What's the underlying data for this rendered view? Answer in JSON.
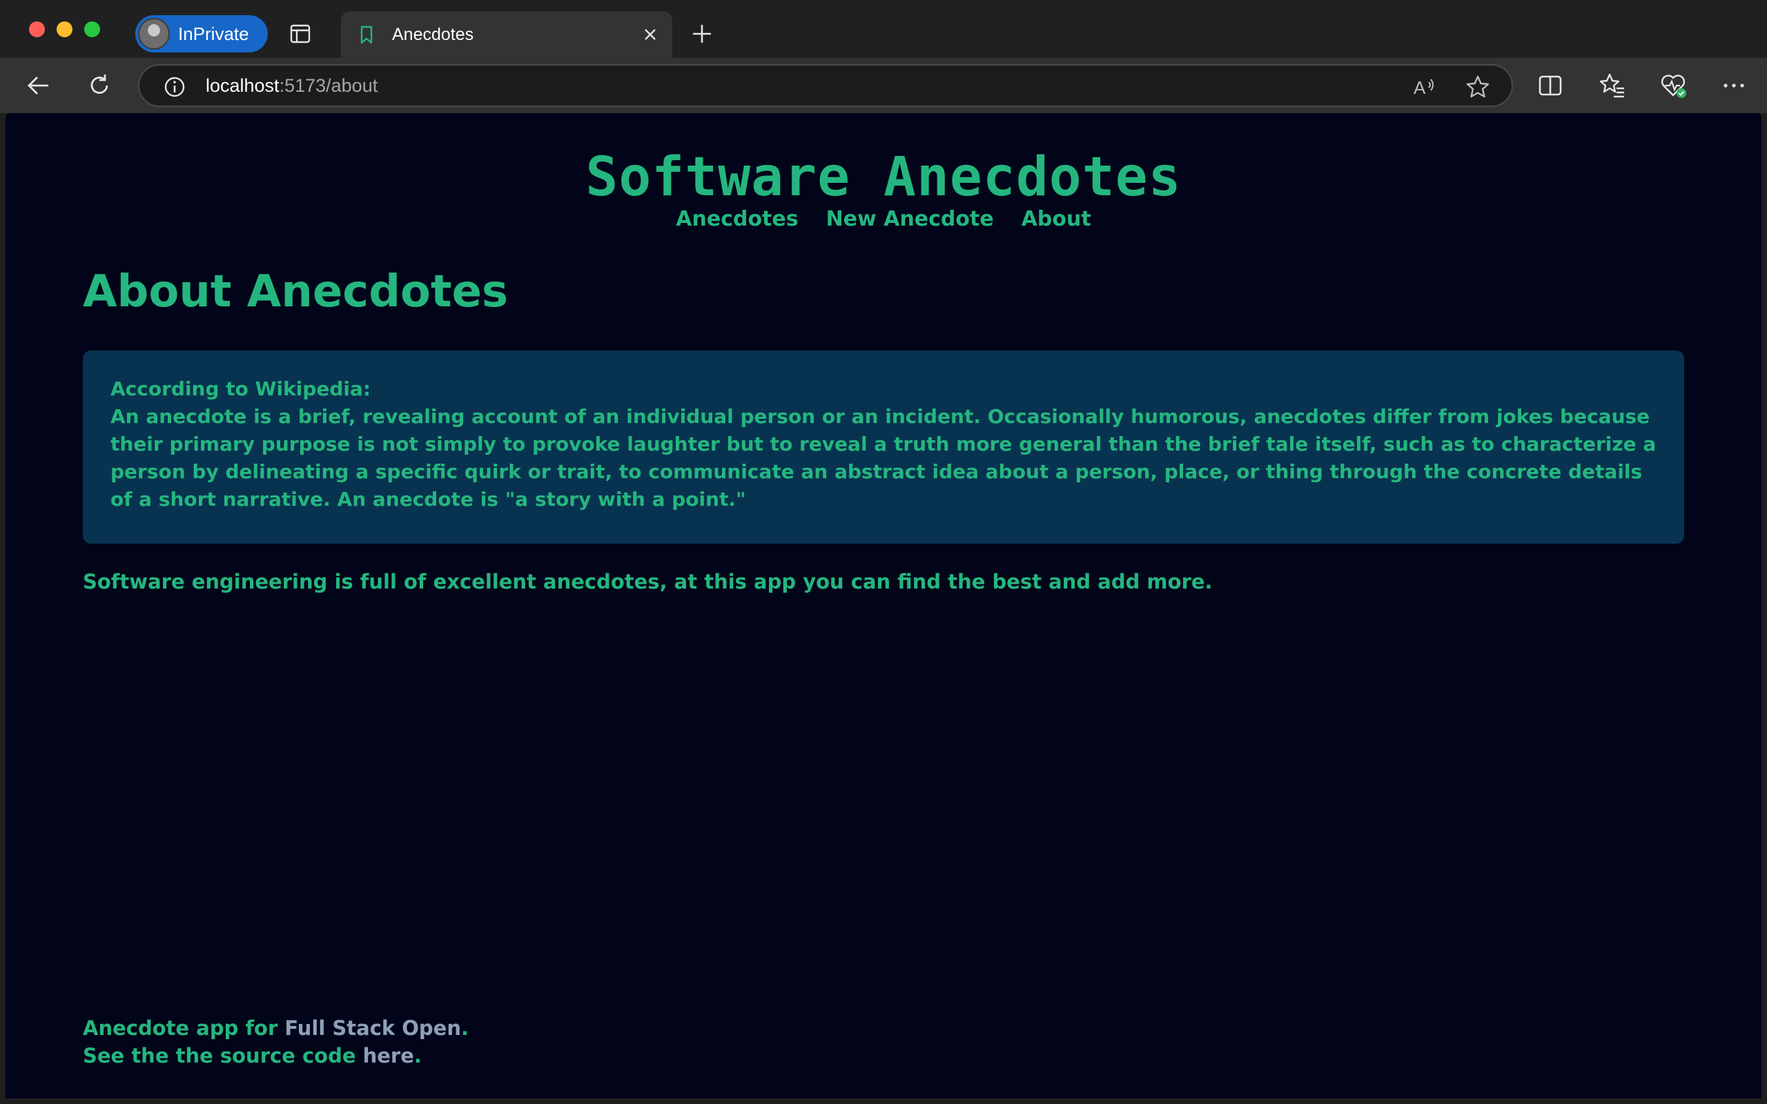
{
  "browser": {
    "inprivate_label": "InPrivate",
    "tab_title": "Anecdotes",
    "url_host": "localhost",
    "url_rest": ":5173/about"
  },
  "page": {
    "site_title": "Software Anecdotes",
    "nav": [
      "Anecdotes",
      "New Anecdote",
      "About"
    ],
    "heading": "About Anecdotes",
    "quote_lead": "According to Wikipedia:",
    "quote_text": "An anecdote is a brief, revealing account of an individual person or an incident. Occasionally humorous, anecdotes differ from jokes because their primary purpose is not simply to provoke laughter but to reveal a truth more general than the brief tale itself, such as to characterize a person by delineating a specific quirk or trait, to communicate an abstract idea about a person, place, or thing through the concrete details of a short narrative. An anecdote is \"a story with a point.\"",
    "intro": "Software engineering is full of excellent anecdotes, at this app you can find the best and add more.",
    "footer": {
      "line1_prefix": "Anecdote app for ",
      "line1_link": "Full Stack Open",
      "line1_suffix": ".",
      "line2_prefix": "See the the source code ",
      "line2_link": "here",
      "line2_suffix": "."
    }
  },
  "colors": {
    "accent": "#25b67f",
    "background": "#02051a",
    "quote_bg": "#083350",
    "link": "#8fa0b6"
  },
  "icons": [
    "back-icon",
    "refresh-icon",
    "info-icon",
    "read-aloud-icon",
    "favorite-star-icon",
    "split-screen-icon",
    "favorites-icon",
    "browser-essentials-icon",
    "more-icon",
    "tab-actions-icon",
    "bookmark-tab-icon",
    "close-icon",
    "new-tab-icon"
  ]
}
